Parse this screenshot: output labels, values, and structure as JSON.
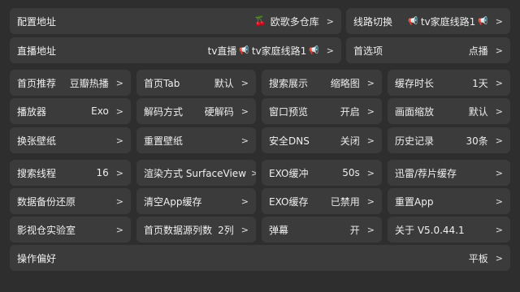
{
  "arrow": ">",
  "rows": [
    [
      {
        "label": "配置地址",
        "value": "欧歌多仓库",
        "icon": "cherry-icon"
      },
      {
        "label": "线路切换",
        "value": "tv家庭线路1",
        "icon": "trumpet-icon"
      }
    ],
    [
      {
        "label": "直播地址",
        "value": "tv直播",
        "value2": "tv家庭线路1",
        "icon": "trumpet-icon"
      },
      {
        "label": "首选项",
        "value": "点播"
      }
    ],
    [
      {
        "label": "首页推荐",
        "value": "豆瓣热播"
      },
      {
        "label": "首页Tab",
        "value": "默认"
      },
      {
        "label": "搜索展示",
        "value": "缩略图"
      },
      {
        "label": "缓存时长",
        "value": "1天"
      }
    ],
    [
      {
        "label": "播放器",
        "value": "Exo"
      },
      {
        "label": "解码方式",
        "value": "硬解码"
      },
      {
        "label": "窗口预览",
        "value": "开启"
      },
      {
        "label": "画面缩放",
        "value": "默认"
      }
    ],
    [
      {
        "label": "换张壁纸",
        "value": ""
      },
      {
        "label": "重置壁纸",
        "value": ""
      },
      {
        "label": "安全DNS",
        "value": "关闭"
      },
      {
        "label": "历史记录",
        "value": "30条"
      }
    ],
    [
      {
        "label": "搜索线程",
        "value": "16"
      },
      {
        "label": "渲染方式 SurfaceView",
        "value": ""
      },
      {
        "label": "EXO缓冲",
        "value": "50s"
      },
      {
        "label": "迅雷/荐片缓存",
        "value": ""
      }
    ],
    [
      {
        "label": "数据备份还原",
        "value": ""
      },
      {
        "label": "清空App缓存",
        "value": ""
      },
      {
        "label": "EXO缓存",
        "value": "已禁用"
      },
      {
        "label": "重置App",
        "value": ""
      }
    ],
    [
      {
        "label": "影视仓实验室",
        "value": ""
      },
      {
        "label": "首页数据源列数",
        "value": "2列"
      },
      {
        "label": "弹幕",
        "value": "开"
      },
      {
        "label": "关于 V5.0.44.1",
        "value": ""
      }
    ],
    [
      {
        "label": "操作偏好",
        "value": "平板"
      }
    ]
  ]
}
